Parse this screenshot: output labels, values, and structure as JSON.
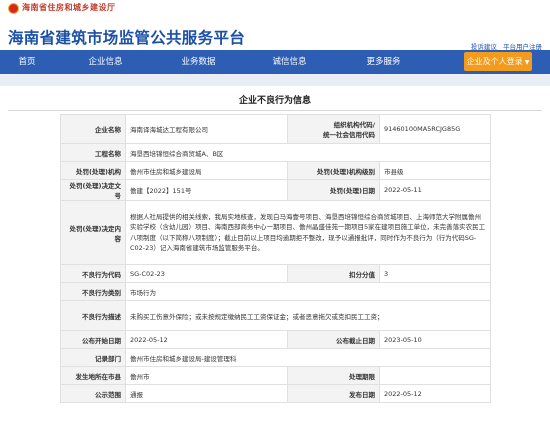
{
  "top": {
    "department": "海南省住房和城乡建设厅",
    "emblem_icon": "national-emblem-icon"
  },
  "header": {
    "site_title": "海南省建筑市场监管公共服务平台",
    "links": [
      "投诉建议",
      "平台用户注册"
    ]
  },
  "nav": {
    "items": [
      "首页",
      "企业信息",
      "业务数据",
      "诚信信息",
      "更多服务"
    ],
    "cta": "企业及个人登录"
  },
  "panel": {
    "title": "企业不良行为信息"
  },
  "record": {
    "company_label": "企业名称",
    "company": "海南译海城达工程有限公司",
    "org_code_label_1": "组织机构代码/",
    "org_code_label_2": "统一社会信用代码",
    "org_code": "91460100MA5RCJG85G",
    "project_label": "工程名称",
    "project": "海垦西培锦恒综合商贸城A、B区",
    "handling_org_label": "处罚(处理)机构",
    "handling_org": "儋州市住房和城乡建设局",
    "org_level_label": "处罚(处理)机构级别",
    "org_level": "市县级",
    "decision_no_label": "处罚(处理)决定文号",
    "decision_no": "儋建【2022】151号",
    "decision_date_label": "处罚(处理)日期",
    "decision_date": "2022-05-11",
    "decision_content_label": "处罚(处理)决定内容",
    "decision_content": "根据人社局提供的相关线索，我局实地核查，发现白马海壹号项目、海垦西培锦恒综合商贸城项目、上海师范大学附属儋州实验学校（含幼儿园）项目、海南西部商务中心一期项目、儋州晶盛佳苑一期项目5家在建项目施工单位，未完善落实农民工八项制度（以下简称八项制度）；截止目前以上项目均逾期拒不整改，现予以通报批评，同时作为不良行为（行为代码SG-C02-23）记入海南省建筑市场监管服务平台。",
    "bad_code_label": "不良行为代码",
    "bad_code": "SG-C02-23",
    "points_label": "扣分分值",
    "points": "3",
    "category_label": "不良行为类别",
    "category": "市场行为",
    "description_label": "不良行为描述",
    "description": "未购买工伤意外保险；或未按规定缴纳民工工资保证金；或者恶意拖欠或克扣民工工资；",
    "publish_date_label": "公布开始日期",
    "publish_date": "2022-05-12",
    "publish_end_label": "公布截止日期",
    "publish_end": "2023-05-10",
    "recorder_label": "记录部门",
    "recorder": "儋州市住房和城乡建设局-建设管理科",
    "location_label": "发生地所在市县",
    "location": "儋州市",
    "deadline_label": "处理期限",
    "deadline": "",
    "public_scope_label": "公示范围",
    "public_scope": "通报",
    "release_date_label": "发布日期",
    "release_date": "2022-05-12"
  },
  "colors": {
    "nav_bg": "#2e5eb4",
    "title_blue": "#1b50a8",
    "cta_orange": "#f39b1e",
    "dept_red": "#c0392b"
  }
}
